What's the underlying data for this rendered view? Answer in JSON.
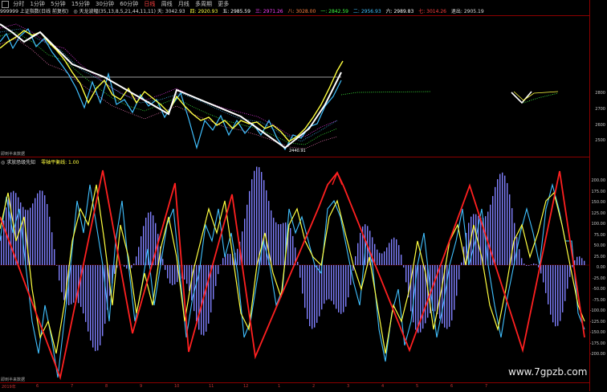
{
  "toolbar": {
    "items": [
      "分时",
      "1分钟",
      "5分钟",
      "15分钟",
      "30分钟",
      "60分钟",
      "日线",
      "周线",
      "月线",
      "多周期",
      "更多"
    ]
  },
  "info": {
    "code": "999999 上证指数(日线 前复权)",
    "indicator": "◎ 天龙波幅(35,13,8,5,21,44,11,11) 天: 3042.93",
    "v1": "四: 2920.93",
    "v2": "五: 2985.59",
    "v3": "三: 2971.26",
    "v4": "八: 3028.00",
    "v5": "一: 2842.59",
    "v6": "二: 2956.93",
    "v7": "六: 2989.83",
    "v8": "七: 3014.26",
    "v9": "退出: 2905.19"
  },
  "upper": {
    "low_label": "2440.91",
    "note": "即到半来数据"
  },
  "lower": {
    "title": "◎ 求放恐级先知",
    "title2": "零轴平衡线: 1.00",
    "note": "即到半来数据"
  },
  "right_axis": {
    "upper": [
      "2800",
      "2700",
      "2600",
      "2500"
    ],
    "lower": [
      "200.00",
      "175.00",
      "150.00",
      "125.00",
      "100.00",
      "75.00",
      "50.00",
      "25.00",
      "0.00",
      "-25.00",
      "-50.00",
      "-75.00",
      "-100.00",
      "-125.00",
      "-150.00",
      "-175.00",
      "-200.00"
    ]
  },
  "bottom_axis": {
    "labels": [
      "2019年",
      "6",
      "7",
      "8",
      "9",
      "10",
      "11",
      "12",
      "1",
      "2",
      "3",
      "4",
      "5",
      "6",
      "7"
    ]
  },
  "watermark": "www.7gpzb.com",
  "colors": {
    "zigzag": "#ff2020",
    "yellow": "#ffff40",
    "cyan": "#40c0ff",
    "bars": "#8080ff",
    "white": "#ffffff",
    "magenta": "#ff40ff"
  }
}
